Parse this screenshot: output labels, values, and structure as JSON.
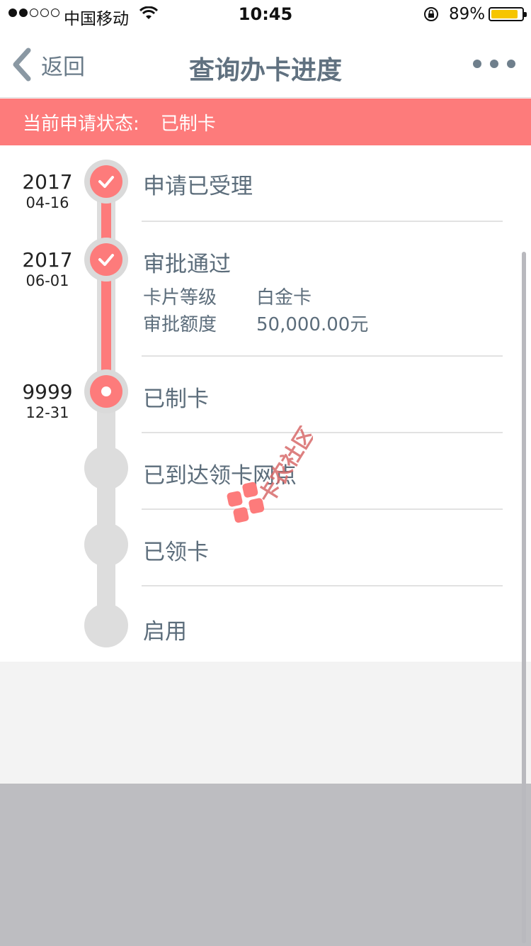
{
  "status_bar": {
    "carrier": "中国移动",
    "time": "10:45",
    "battery": "89%",
    "battery_level": 0.89,
    "battery_color": "#f6c500"
  },
  "nav": {
    "back_label": "返回",
    "title": "查询办卡进度",
    "back_icon": "chevron-left-icon",
    "more_icon": "more-horizontal-icon"
  },
  "banner": {
    "label": "当前申请状态:",
    "value": "已制卡",
    "color": "#fd7b7b"
  },
  "steps": [
    {
      "year": "2017",
      "day": "04-16",
      "title": "申请已受理",
      "state": "done"
    },
    {
      "year": "2017",
      "day": "06-01",
      "title": "审批通过",
      "state": "done",
      "details": [
        {
          "key": "卡片等级",
          "value": "白金卡"
        },
        {
          "key": "审批额度",
          "value": "50,000.00元"
        }
      ]
    },
    {
      "year": "9999",
      "day": "12-31",
      "title": "已制卡",
      "state": "current"
    },
    {
      "title": "已到达领卡网点",
      "state": "pending"
    },
    {
      "title": "已领卡",
      "state": "pending"
    },
    {
      "title": "启用",
      "state": "pending"
    }
  ],
  "watermark": {
    "text": "卡农社区"
  }
}
